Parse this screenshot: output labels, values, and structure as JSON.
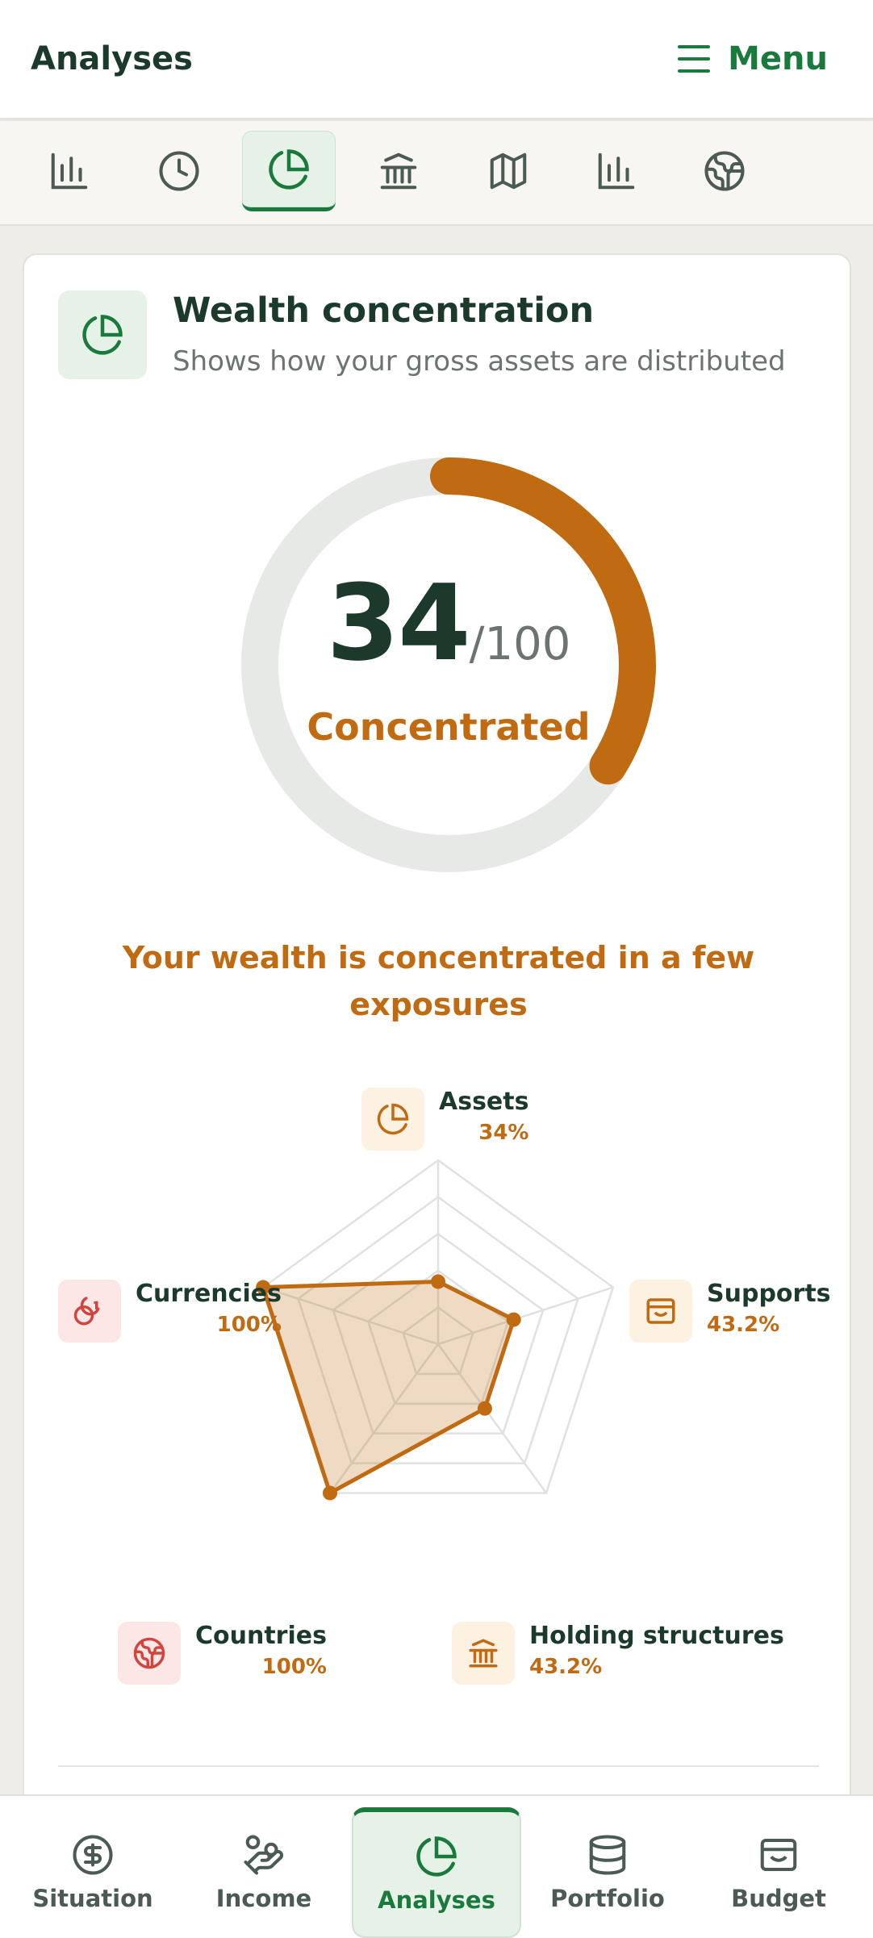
{
  "header": {
    "title": "Analyses",
    "menu_label": "Menu"
  },
  "icon_tabs": [
    "bar-chart-icon",
    "clock-icon",
    "pie-chart-icon",
    "bank-icon",
    "map-icon",
    "bar-chart-icon",
    "globe-icon"
  ],
  "active_tab": 2,
  "card": {
    "title": "Wealth concentration",
    "subtitle": "Shows how your gross assets are distributed",
    "score": "34",
    "score_max": "/100",
    "score_fraction": 0.34,
    "score_label": "Concentrated",
    "headline": "Your wealth is concentrated in a few exposures"
  },
  "axes": [
    {
      "name": "Assets",
      "value": "34%",
      "fraction": 0.34,
      "icon": "pie-chart-icon",
      "tone": "orange"
    },
    {
      "name": "Supports",
      "value": "43.2%",
      "fraction": 0.432,
      "icon": "wallet-icon",
      "tone": "orange"
    },
    {
      "name": "Holding structures",
      "value": "43.2%",
      "fraction": 0.432,
      "icon": "bank-icon",
      "tone": "orange"
    },
    {
      "name": "Countries",
      "value": "100%",
      "fraction": 1.0,
      "icon": "globe-icon",
      "tone": "red"
    },
    {
      "name": "Currencies",
      "value": "100%",
      "fraction": 1.0,
      "icon": "coins-icon",
      "tone": "red"
    }
  ],
  "colors": {
    "accent": "#1a7a3c",
    "warning": "#c06a12",
    "danger": "#d0453d",
    "track": "#e6e9e6"
  },
  "bottom_nav": [
    {
      "label": "Situation",
      "icon": "dollar-icon"
    },
    {
      "label": "Income",
      "icon": "hand-coin-icon"
    },
    {
      "label": "Analyses",
      "icon": "pie-chart-icon"
    },
    {
      "label": "Portfolio",
      "icon": "database-icon"
    },
    {
      "label": "Budget",
      "icon": "wallet-icon"
    }
  ],
  "active_nav": 2
}
